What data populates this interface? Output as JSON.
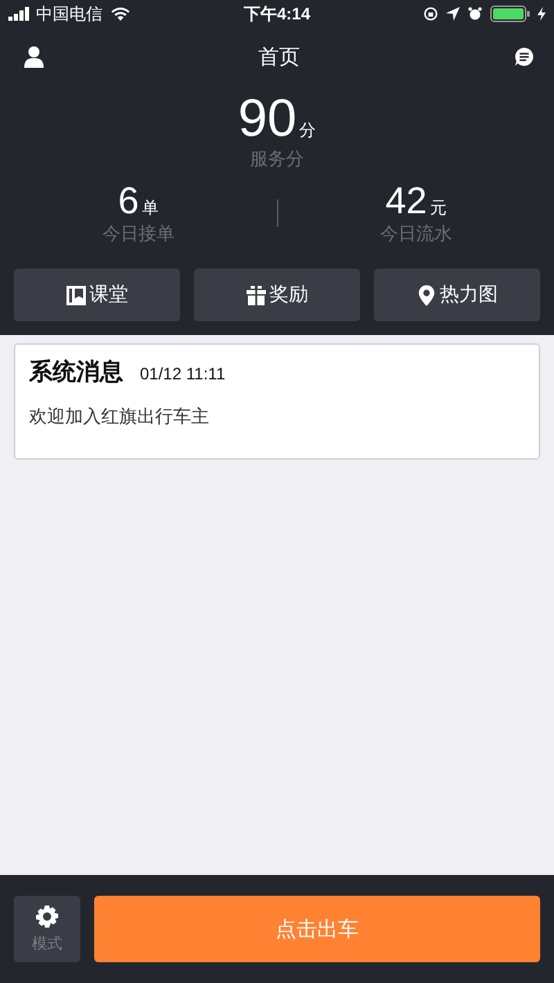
{
  "status_bar": {
    "carrier": "中国电信",
    "time": "下午4:14"
  },
  "header": {
    "title": "首页"
  },
  "score": {
    "value": "90",
    "unit": "分",
    "label": "服务分"
  },
  "stats": [
    {
      "value": "6",
      "unit": "单",
      "label": "今日接单"
    },
    {
      "value": "42",
      "unit": "元",
      "label": "今日流水"
    }
  ],
  "shortcuts": [
    {
      "kind": "class",
      "label": "课堂"
    },
    {
      "kind": "gift",
      "label": "奖励"
    },
    {
      "kind": "pin",
      "label": "热力图"
    }
  ],
  "messages": [
    {
      "title": "系统消息",
      "time": "01/12 11:11",
      "body": "欢迎加入红旗出行车主"
    }
  ],
  "footer": {
    "mode_label": "模式",
    "start_button": "点击出车"
  }
}
